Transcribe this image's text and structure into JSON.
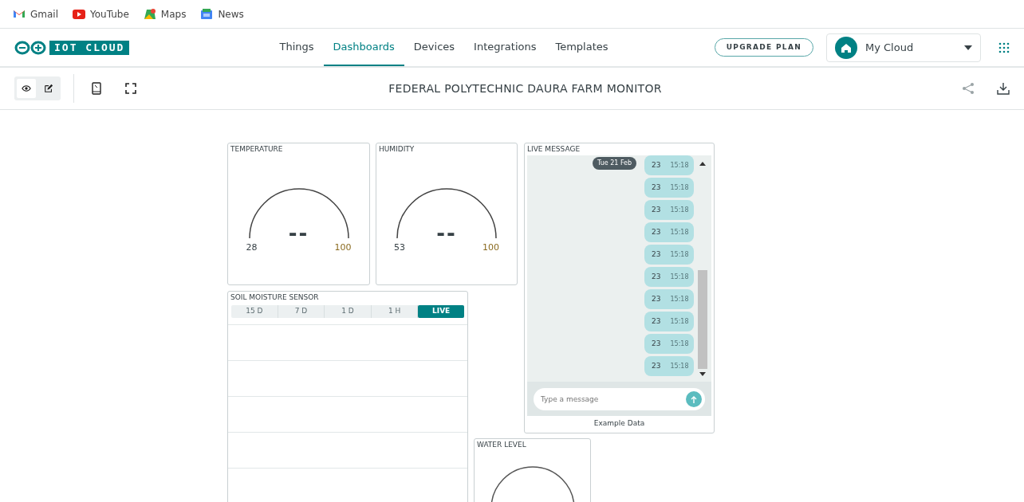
{
  "bookmarks": [
    {
      "kind": "gmail",
      "label": "Gmail"
    },
    {
      "kind": "youtube",
      "label": "YouTube"
    },
    {
      "kind": "maps",
      "label": "Maps"
    },
    {
      "kind": "news",
      "label": "News"
    }
  ],
  "brand": {
    "logo_text": "IOT CLOUD"
  },
  "nav": [
    {
      "label": "Things",
      "selected": false
    },
    {
      "label": "Dashboards",
      "selected": true
    },
    {
      "label": "Devices",
      "selected": false
    },
    {
      "label": "Integrations",
      "selected": false
    },
    {
      "label": "Templates",
      "selected": false
    }
  ],
  "upgrade_button": "UPGRADE PLAN",
  "space_selector": {
    "value": "My Cloud"
  },
  "toolbar": {
    "modes": [
      {
        "kind": "view",
        "selected": true
      },
      {
        "kind": "edit",
        "selected": false
      }
    ],
    "title": "FEDERAL POLYTECHNIC DAURA FARM MONITOR"
  },
  "widgets": [
    {
      "kind": "gauge",
      "title": "TEMPERATURE",
      "min": "28",
      "max": "100",
      "value": "--"
    },
    {
      "kind": "gauge",
      "title": "HUMIDITY",
      "min": "53",
      "max": "100",
      "value": "--"
    },
    {
      "kind": "messenger",
      "title": "LIVE MESSAGE",
      "date": "Tue 21 Feb",
      "placeholder": "Type a message",
      "footer": "Example Data",
      "messages": [
        {
          "text": "23",
          "time": "15:18"
        },
        {
          "text": "23",
          "time": "15:18"
        },
        {
          "text": "23",
          "time": "15:18"
        },
        {
          "text": "23",
          "time": "15:18"
        },
        {
          "text": "23",
          "time": "15:18"
        },
        {
          "text": "23",
          "time": "15:18"
        },
        {
          "text": "23",
          "time": "15:18"
        },
        {
          "text": "23",
          "time": "15:18"
        },
        {
          "text": "23",
          "time": "15:18"
        },
        {
          "text": "23",
          "time": "15:18"
        }
      ]
    },
    {
      "kind": "chart",
      "title": "SOIL MOISTURE SENSOR",
      "ranges": [
        {
          "label": "15 D",
          "selected": false
        },
        {
          "label": "7 D",
          "selected": false
        },
        {
          "label": "1 D",
          "selected": false
        },
        {
          "label": "1 H",
          "selected": false
        },
        {
          "label": "LIVE",
          "selected": true
        }
      ]
    },
    {
      "kind": "percentage",
      "title": "WATER LEVEL"
    }
  ]
}
